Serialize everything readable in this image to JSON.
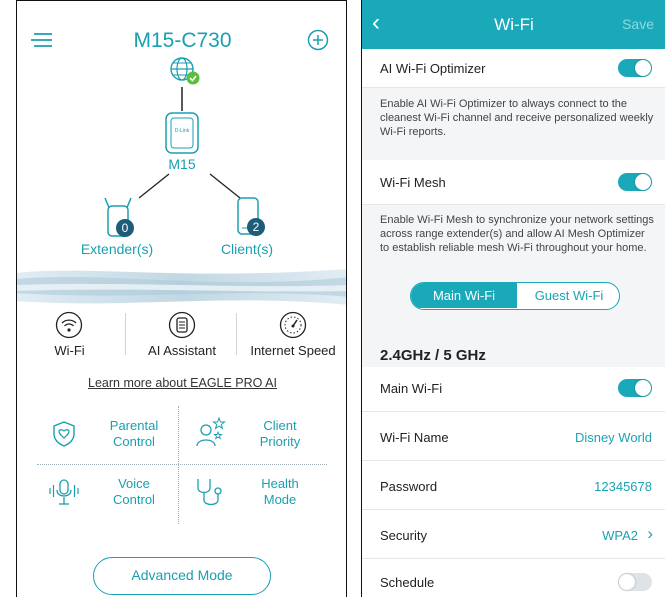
{
  "left": {
    "device_title": "M15-C730",
    "router_label": "M15",
    "extender": {
      "label": "Extender(s)",
      "count": "0"
    },
    "client": {
      "label": "Client(s)",
      "count": "2"
    },
    "quick": [
      {
        "label": "Wi-Fi",
        "icon": "wifi-icon"
      },
      {
        "label": "AI Assistant",
        "icon": "ai-assistant-icon"
      },
      {
        "label": "Internet Speed",
        "icon": "speedometer-icon"
      }
    ],
    "learn_more": "Learn more about EAGLE PRO AI",
    "features": [
      {
        "line1": "Parental",
        "line2": "Control",
        "icon": "shield-heart-icon"
      },
      {
        "line1": "Client",
        "line2": "Priority",
        "icon": "client-star-icon"
      },
      {
        "line1": "Voice",
        "line2": "Control",
        "icon": "microphone-icon"
      },
      {
        "line1": "Health",
        "line2": "Mode",
        "icon": "stethoscope-icon"
      }
    ],
    "advanced_button": "Advanced Mode",
    "brand_on_device": "D-Link"
  },
  "right": {
    "header": {
      "title": "Wi-Fi",
      "save": "Save"
    },
    "ai_optimizer": {
      "label": "AI Wi-Fi Optimizer",
      "on": true,
      "desc": "Enable AI Wi-Fi Optimizer to always connect to the cleanest Wi-Fi channel and receive personalized weekly Wi-Fi reports."
    },
    "mesh": {
      "label": "Wi-Fi Mesh",
      "on": true,
      "desc": "Enable Wi-Fi Mesh to synchronize your network settings across range extender(s) and allow AI Mesh Optimizer to establish reliable mesh Wi-Fi throughout your home."
    },
    "tabs": [
      "Main Wi-Fi",
      "Guest Wi-Fi"
    ],
    "band_title": "2.4GHz / 5 GHz",
    "main_wifi": {
      "label": "Main Wi-Fi",
      "on": true
    },
    "wifi_name": {
      "label": "Wi-Fi Name",
      "value": "Disney World"
    },
    "password": {
      "label": "Password",
      "value": "12345678"
    },
    "security": {
      "label": "Security",
      "value": "WPA2"
    },
    "schedule": {
      "label": "Schedule",
      "on": false
    }
  },
  "colors": {
    "accent": "#1aa9b9",
    "text": "#222222",
    "background": "#f4f5f6"
  }
}
